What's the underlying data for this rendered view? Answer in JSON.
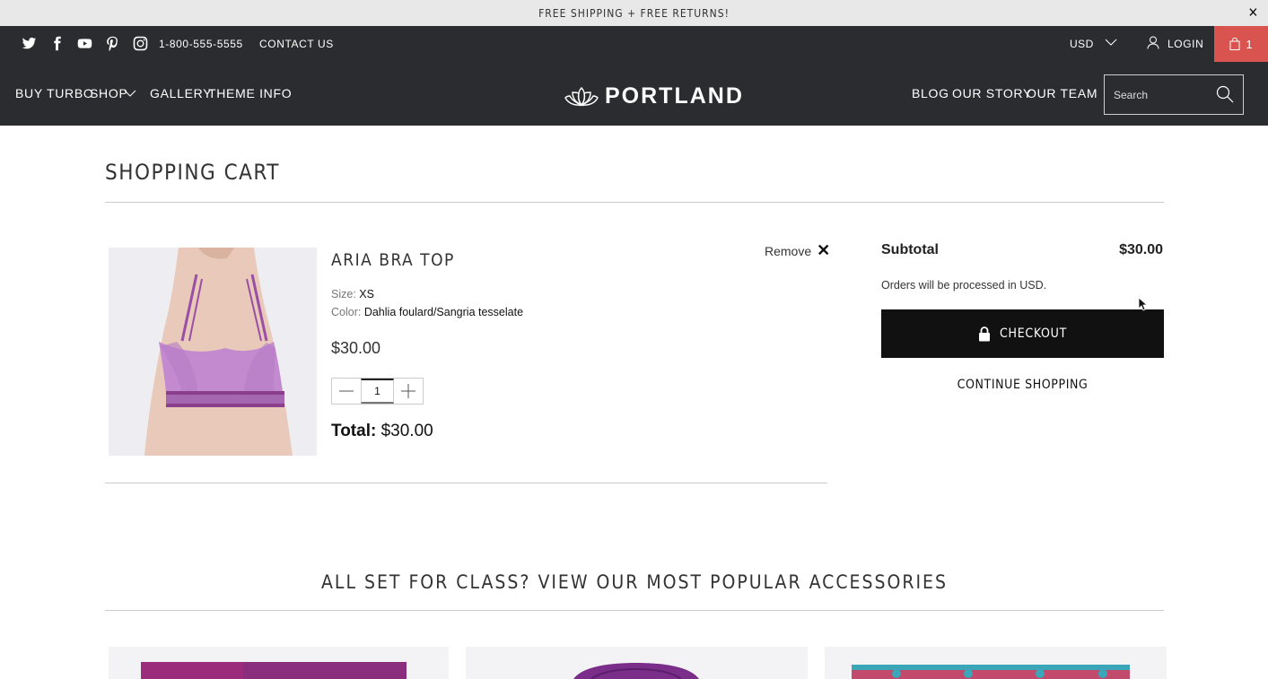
{
  "announcement": {
    "text": "FREE SHIPPING + FREE RETURNS!",
    "close": "✕"
  },
  "topbar": {
    "social_icons": [
      "twitter-icon",
      "facebook-icon",
      "youtube-icon",
      "pinterest-icon",
      "instagram-icon"
    ],
    "phone": "1-800-555-5555",
    "contact": "CONTACT US",
    "currency": "USD",
    "login": "LOGIN",
    "cart_count": "1",
    "cart_color": "#d9534f"
  },
  "nav": {
    "left": [
      "BUY TURBO",
      "SHOP",
      "GALLERY",
      "THEME INFO"
    ],
    "logo": "PORTLAND",
    "right": [
      "BLOG",
      "OUR STORY",
      "OUR TEAM"
    ],
    "search_placeholder": "Search"
  },
  "cart": {
    "title": "SHOPPING CART",
    "item": {
      "name": "ARIA BRA TOP",
      "remove": "Remove",
      "size_label": "Size:",
      "size_value": "XS",
      "color_label": "Color:",
      "color_value": "Dahlia foulard/Sangria tesselate",
      "price": "$30.00",
      "quantity": "1",
      "total_label": "Total:",
      "total_value": "$30.00"
    },
    "summary": {
      "subtotal_label": "Subtotal",
      "subtotal_value": "$30.00",
      "note": "Orders will be processed in USD.",
      "checkout": "CHECKOUT",
      "continue": "CONTINUE SHOPPING"
    }
  },
  "accessories": {
    "title": "ALL SET FOR CLASS? VIEW OUR MOST POPULAR ACCESSORIES"
  }
}
